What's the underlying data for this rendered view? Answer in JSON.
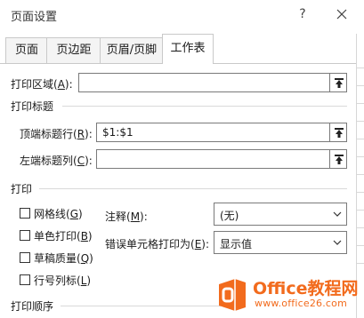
{
  "window": {
    "title": "页面设置",
    "help_label": "?",
    "close_label": "✕"
  },
  "tabs": [
    {
      "label": "页面",
      "active": false
    },
    {
      "label": "页边距",
      "active": false
    },
    {
      "label": "页眉/页脚",
      "active": false
    },
    {
      "label": "工作表",
      "active": true
    }
  ],
  "print_area": {
    "label_main": "打印区域(",
    "label_key": "A",
    "label_end": "):",
    "value": ""
  },
  "print_titles": {
    "section_title": "打印标题",
    "top_rows": {
      "label_main": "顶端标题行(",
      "label_key": "R",
      "label_end": "):",
      "value": "$1:$1"
    },
    "left_cols": {
      "label_main": "左端标题列(",
      "label_key": "C",
      "label_end": "):",
      "value": ""
    }
  },
  "print": {
    "section_title": "打印",
    "checkboxes": [
      {
        "label_main": "网格线(",
        "label_key": "G",
        "label_end": ")",
        "checked": false
      },
      {
        "label_main": "单色打印(",
        "label_key": "B",
        "label_end": ")",
        "checked": false
      },
      {
        "label_main": "草稿质量(",
        "label_key": "Q",
        "label_end": ")",
        "checked": false
      },
      {
        "label_main": "行号列标(",
        "label_key": "L",
        "label_end": ")",
        "checked": false
      }
    ],
    "comments": {
      "label_main": "注释(",
      "label_key": "M",
      "label_end": "):",
      "value": "(无)"
    },
    "errors": {
      "label_main": "错误单元格打印为(",
      "label_key": "E",
      "label_end": "):",
      "value": "显示值"
    }
  },
  "print_order": {
    "section_title": "打印顺序"
  },
  "watermark": {
    "brand": "Office教程网",
    "url": "www.office26.com"
  },
  "colors": {
    "accent": "#f26b1d",
    "border": "#7a7a7a"
  }
}
